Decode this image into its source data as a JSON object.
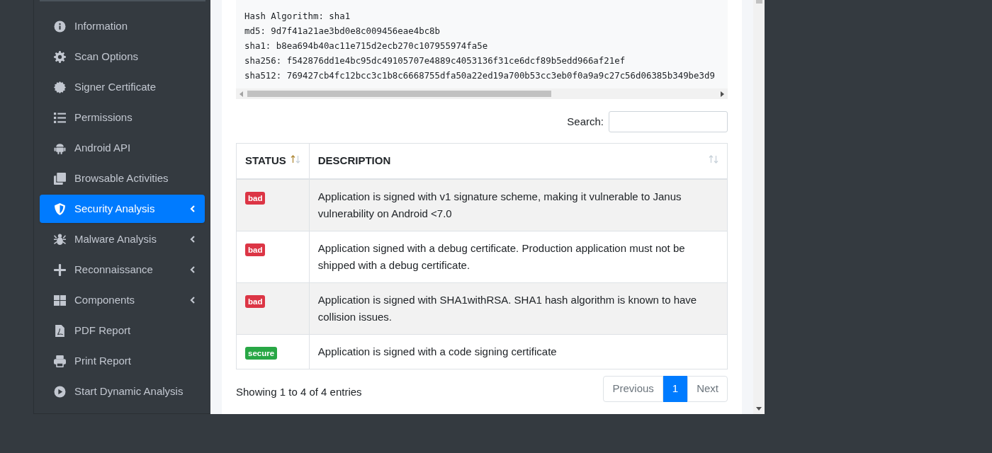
{
  "sidebar": {
    "items": [
      {
        "label": "Information",
        "selected": false,
        "submenu": false
      },
      {
        "label": "Scan Options",
        "selected": false,
        "submenu": false
      },
      {
        "label": "Signer Certificate",
        "selected": false,
        "submenu": false
      },
      {
        "label": "Permissions",
        "selected": false,
        "submenu": false
      },
      {
        "label": "Android API",
        "selected": false,
        "submenu": false
      },
      {
        "label": "Browsable Activities",
        "selected": false,
        "submenu": false
      },
      {
        "label": "Security Analysis",
        "selected": true,
        "submenu": true
      },
      {
        "label": "Malware Analysis",
        "selected": false,
        "submenu": true
      },
      {
        "label": "Reconnaissance",
        "selected": false,
        "submenu": true
      },
      {
        "label": "Components",
        "selected": false,
        "submenu": true
      },
      {
        "label": "PDF Report",
        "selected": false,
        "submenu": false
      },
      {
        "label": "Print Report",
        "selected": false,
        "submenu": false
      },
      {
        "label": "Start Dynamic Analysis",
        "selected": false,
        "submenu": false
      }
    ]
  },
  "certificate_lines": [
    "Hash Algorithm: sha1",
    "md5: 9d7f41a21ae3bd0e8c009456eae4bc8b",
    "sha1: b8ea694b40ac11e715d2ecb270c107955974fa5e",
    "sha256: f542876dd1e4bc95dc49105707e4889c4053136f31ce6dcf89b5edd966af21ef",
    "sha512: 769427cb4fc12bcc3c1b8c6668755dfa50a22ed19a700b53cc3eb0f0a9a9c27c56d06385b349be3d9"
  ],
  "search": {
    "label": "Search:"
  },
  "table": {
    "columns": [
      {
        "label": "STATUS",
        "sorted": true
      },
      {
        "label": "DESCRIPTION",
        "sorted": false
      }
    ],
    "rows": [
      {
        "status": "bad",
        "kind": "bad",
        "description": "Application is signed with v1 signature scheme, making it vulnerable to Janus vulnerability on Android <7.0"
      },
      {
        "status": "bad",
        "kind": "bad",
        "description": "Application signed with a debug certificate. Production application must not be shipped with a debug certificate."
      },
      {
        "status": "bad",
        "kind": "bad",
        "description": "Application is signed with SHA1withRSA. SHA1 hash algorithm is known to have collision issues."
      },
      {
        "status": "secure",
        "kind": "secure",
        "description": "Application is signed with a code signing certificate"
      }
    ]
  },
  "footer": {
    "info": "Showing 1 to 4 of 4 entries",
    "pagination": [
      {
        "label": "Previous",
        "selected": false
      },
      {
        "label": "1",
        "selected": true
      },
      {
        "label": "Next",
        "selected": false
      }
    ]
  }
}
